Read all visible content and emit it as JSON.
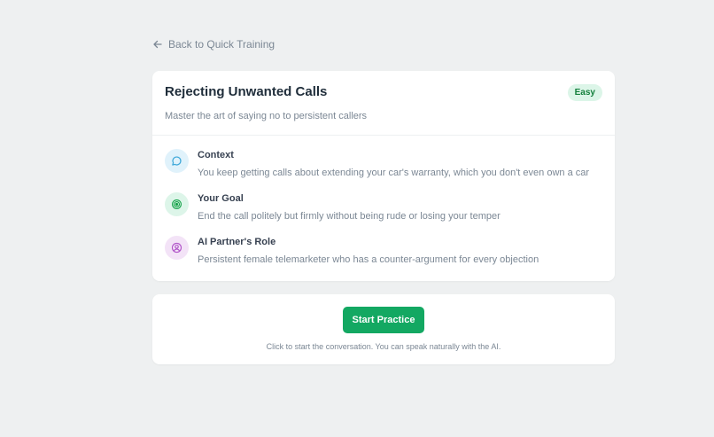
{
  "nav": {
    "back_label": "Back to Quick Training"
  },
  "scenario": {
    "title": "Rejecting Unwanted Calls",
    "difficulty": "Easy",
    "subtitle": "Master the art of saying no to persistent callers",
    "details": [
      {
        "label": "Context",
        "text": "You keep getting calls about extending your car's warranty, which you don't even own a car",
        "icon": "chat-bubble-icon"
      },
      {
        "label": "Your Goal",
        "text": "End the call politely but firmly without being rude or losing your temper",
        "icon": "target-icon"
      },
      {
        "label": "AI Partner's Role",
        "text": "Persistent female telemarketer who has a counter-argument for every objection",
        "icon": "user-circle-icon"
      }
    ]
  },
  "action": {
    "start_label": "Start Practice",
    "hint": "Click to start the conversation. You can speak naturally with the AI."
  },
  "colors": {
    "background": "#eef0f1",
    "accent": "#13a862",
    "badge_bg": "#dcf5e8",
    "badge_text": "#15803d",
    "context_icon": "#3aa6d8",
    "goal_icon": "#16a34a",
    "role_icon": "#b054c8"
  }
}
